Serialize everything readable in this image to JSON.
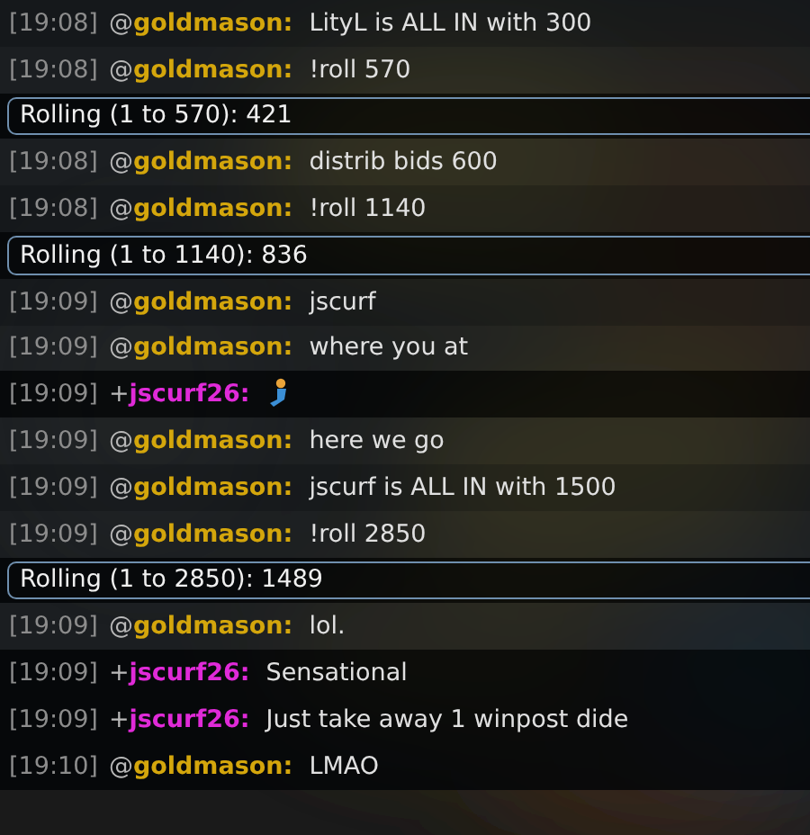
{
  "messages": [
    {
      "kind": "message",
      "time": "[19:08]",
      "prefix": "@",
      "user": "goldmason:",
      "color": "#d4a60c",
      "text": "LityL is ALL IN with 300"
    },
    {
      "kind": "message",
      "time": "[19:08]",
      "prefix": "@",
      "user": "goldmason:",
      "color": "#d4a60c",
      "text": "!roll 570"
    },
    {
      "kind": "roll",
      "text": "Rolling (1 to 570): 421"
    },
    {
      "kind": "message",
      "time": "[19:08]",
      "prefix": "@",
      "user": "goldmason:",
      "color": "#d4a60c",
      "text": "distrib bids 600"
    },
    {
      "kind": "message",
      "time": "[19:08]",
      "prefix": "@",
      "user": "goldmason:",
      "color": "#d4a60c",
      "text": "!roll 1140"
    },
    {
      "kind": "roll",
      "text": "Rolling (1 to 1140): 836"
    },
    {
      "kind": "message",
      "time": "[19:09]",
      "prefix": "@",
      "user": "goldmason:",
      "color": "#d4a60c",
      "text": "jscurf"
    },
    {
      "kind": "message",
      "time": "[19:09]",
      "prefix": "@",
      "user": "goldmason:",
      "color": "#d4a60c",
      "text": "where you at"
    },
    {
      "kind": "emoji",
      "time": "[19:09]",
      "prefix": "+",
      "user": "jscurf26:",
      "color": "#e02ad8"
    },
    {
      "kind": "message",
      "time": "[19:09]",
      "prefix": "@",
      "user": "goldmason:",
      "color": "#d4a60c",
      "text": "here we go"
    },
    {
      "kind": "message",
      "time": "[19:09]",
      "prefix": "@",
      "user": "goldmason:",
      "color": "#d4a60c",
      "text": "jscurf is ALL IN with 1500"
    },
    {
      "kind": "message",
      "time": "[19:09]",
      "prefix": "@",
      "user": "goldmason:",
      "color": "#d4a60c",
      "text": "!roll 2850"
    },
    {
      "kind": "roll",
      "text": "Rolling (1 to 2850): 1489"
    },
    {
      "kind": "message",
      "time": "[19:09]",
      "prefix": "@",
      "user": "goldmason:",
      "color": "#d4a60c",
      "text": "lol."
    },
    {
      "kind": "message",
      "time": "[19:09]",
      "prefix": "+",
      "user": "jscurf26:",
      "color": "#e02ad8",
      "text": "Sensational"
    },
    {
      "kind": "message",
      "time": "[19:09]",
      "prefix": "+",
      "user": "jscurf26:",
      "color": "#e02ad8",
      "text": "Just take away 1 winpost dide"
    },
    {
      "kind": "message",
      "time": "[19:10]",
      "prefix": "@",
      "user": "goldmason:",
      "color": "#d4a60c",
      "text": "LMAO"
    }
  ]
}
